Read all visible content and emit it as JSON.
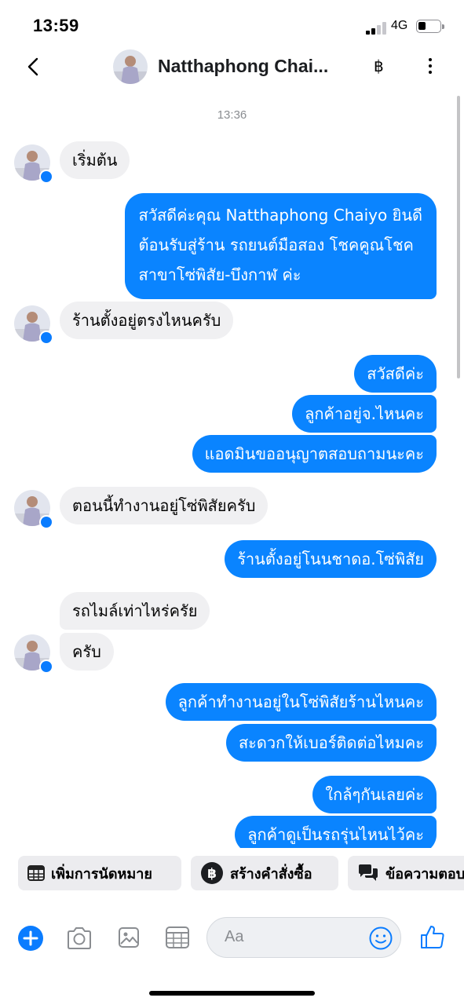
{
  "status": {
    "time": "13:59",
    "network": "4G"
  },
  "header": {
    "contact_name": "Natthaphong Chai...",
    "baht_symbol": "฿"
  },
  "chat": {
    "timestamp": "13:36",
    "messages": [
      {
        "dir": "in",
        "lines": [
          "เริ่มต้น"
        ]
      },
      {
        "dir": "out",
        "lines": [
          "สวัสดีค่ะคุณ Natthaphong Chaiyo ยินดี",
          "ต้อนรับสู่ร้าน รถยนต์มือสอง โชคคูณโชค",
          "สาขาโซ่พิสัย-บึงกาฬ ค่ะ"
        ]
      },
      {
        "dir": "in",
        "lines": [
          "ร้านตั้งอยู่ตรงไหนครับ"
        ]
      },
      {
        "dir": "out",
        "lines": [
          "สวัสดีค่ะ"
        ]
      },
      {
        "dir": "out",
        "lines": [
          "ลูกค้าอยู่จ.ไหนคะ"
        ]
      },
      {
        "dir": "out",
        "lines": [
          "แอดมินขออนุญาตสอบถามนะคะ"
        ]
      },
      {
        "dir": "in",
        "lines": [
          "ตอนนี้ทำงานอยู่โซ่พิสัยครับ"
        ]
      },
      {
        "dir": "out",
        "lines": [
          "ร้านตั้งอยู่โนนชาดอ.โซ่พิสัย"
        ]
      },
      {
        "dir": "in",
        "lines": [
          "รถไมล์เท่าไหร่ครัย"
        ]
      },
      {
        "dir": "in",
        "lines": [
          "ครับ"
        ]
      },
      {
        "dir": "out",
        "lines": [
          "ลูกค้าทำงานอยู่ในโซ่พิสัยร้านไหนคะ"
        ]
      },
      {
        "dir": "out",
        "lines": [
          "สะดวกให้เบอร์ติดต่อไหมคะ"
        ]
      },
      {
        "dir": "out",
        "lines": [
          "ใกล้ๆกันเลยค่ะ"
        ]
      },
      {
        "dir": "out",
        "lines": [
          "ลูกค้าดูเป็นรถรุ่นไหนไว้คะ"
        ]
      }
    ]
  },
  "quick_actions": [
    {
      "label": "เพิ่มการนัดหมาย",
      "icon": "calendar-icon"
    },
    {
      "label": "สร้างคำสั่งซื้อ",
      "icon": "baht-coin-icon"
    },
    {
      "label": "ข้อความตอบกลับ",
      "icon": "chat-bubbles-icon"
    }
  ],
  "composer": {
    "placeholder": "Aa"
  },
  "colors": {
    "accent": "#0a84ff",
    "incoming": "#f0f0f2"
  }
}
